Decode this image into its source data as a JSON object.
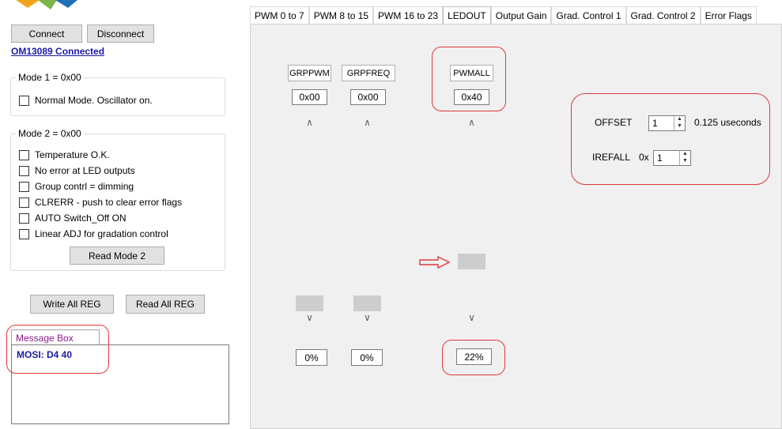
{
  "left": {
    "connect_label": "Connect",
    "disconnect_label": "Disconnect",
    "connection_status": "OM13089 Connected",
    "mode1": {
      "title": "Mode 1 = 0x00",
      "items": [
        "Normal Mode. Oscillator on."
      ]
    },
    "mode2": {
      "title": "Mode 2 = 0x00",
      "items": [
        "Temperature O.K.",
        "No error at LED outputs",
        "Group contrl = dimming",
        "CLRERR - push to clear error flags",
        "AUTO Switch_Off ON",
        "Linear ADJ for gradation control"
      ],
      "read_label": "Read Mode 2"
    },
    "write_all_label": "Write All REG",
    "read_all_label": "Read All REG",
    "message_box": {
      "tab_label": "Message Box",
      "text": "MOSI: D4 40"
    }
  },
  "tabs": [
    "PWM 0 to 7",
    "PWM 8 to 15",
    "PWM 16 to 23",
    "LEDOUT",
    "Output Gain",
    "Grad. Control 1",
    "Grad. Control 2",
    "Error Flags"
  ],
  "active_tab": "LEDOUT",
  "sliders": [
    {
      "label": "GRPPWM",
      "hex": "0x00",
      "percent": "0%",
      "level": 0
    },
    {
      "label": "GRPFREQ",
      "hex": "0x00",
      "percent": "0%",
      "level": 0
    },
    {
      "label": "PWMALL",
      "hex": "0x40",
      "percent": "22%",
      "level": 0.25
    }
  ],
  "offset": {
    "label": "OFFSET",
    "value": "1",
    "unit": "0.125 useconds"
  },
  "irefall": {
    "label": "IREFALL",
    "prefix": "0x",
    "value": "1"
  },
  "colors": {
    "highlight": "#e0393b",
    "link": "#1a1aa8",
    "message": "#8b1a8b"
  }
}
